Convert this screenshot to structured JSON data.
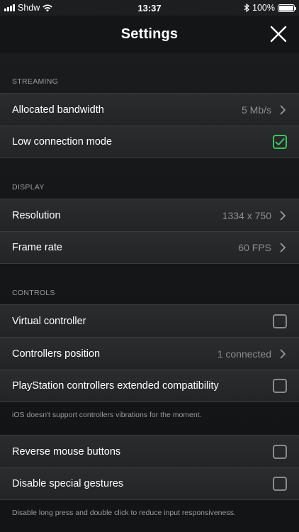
{
  "status_bar": {
    "carrier": "Shdw",
    "time": "13:37",
    "battery_percent": "100%",
    "icons": [
      "signal-icon",
      "wifi-icon",
      "bluetooth-icon",
      "battery-icon"
    ]
  },
  "nav": {
    "title": "Settings",
    "close_icon": "close-icon"
  },
  "accent_color": "#35c759",
  "sections": {
    "streaming": {
      "header": "STREAMING",
      "bandwidth": {
        "label": "Allocated bandwidth",
        "value": "5 Mb/s"
      },
      "low_connection": {
        "label": "Low connection mode",
        "checked": true
      }
    },
    "display": {
      "header": "DISPLAY",
      "resolution": {
        "label": "Resolution",
        "value": "1334 x 750"
      },
      "frame_rate": {
        "label": "Frame rate",
        "value": "60 FPS"
      }
    },
    "controls": {
      "header": "CONTROLS",
      "virtual_controller": {
        "label": "Virtual controller",
        "checked": false
      },
      "controllers_position": {
        "label": "Controllers position",
        "value": "1 connected"
      },
      "ps_compat": {
        "label": "PlayStation controllers extended compatibility",
        "checked": false
      },
      "footnote": "iOS doesn't support controllers vibrations for the moment."
    },
    "mouse": {
      "reverse_mouse": {
        "label": "Reverse mouse buttons",
        "checked": false
      },
      "disable_gestures": {
        "label": "Disable special gestures",
        "checked": false
      },
      "footnote": "Disable long press and double click to reduce input responsiveness."
    }
  }
}
